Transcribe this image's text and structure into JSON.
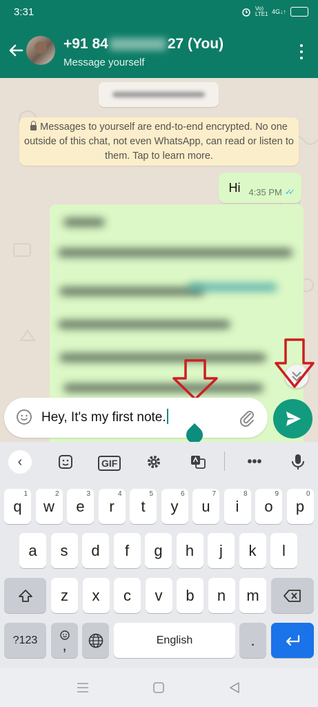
{
  "status": {
    "time": "3:31",
    "net": "Vo) LTE1",
    "sim": "4G↓↑",
    "battery": "47"
  },
  "header": {
    "phone_prefix": "+91 84",
    "phone_suffix": "27 (You)",
    "subtitle": "Message yourself"
  },
  "chat": {
    "notice": "Messages to yourself are end-to-end encrypted. No one outside of this chat, not even WhatsApp, can read or listen to them. Tap to learn more.",
    "out_text": "Hi",
    "out_time": "4:35 PM",
    "ticks": "✓✓"
  },
  "composer": {
    "text": "Hey, It's my first note."
  },
  "keyboard": {
    "gif": "GIF",
    "row1": [
      {
        "k": "q",
        "n": "1"
      },
      {
        "k": "w",
        "n": "2"
      },
      {
        "k": "e",
        "n": "3"
      },
      {
        "k": "r",
        "n": "4"
      },
      {
        "k": "t",
        "n": "5"
      },
      {
        "k": "y",
        "n": "6"
      },
      {
        "k": "u",
        "n": "7"
      },
      {
        "k": "i",
        "n": "8"
      },
      {
        "k": "o",
        "n": "9"
      },
      {
        "k": "p",
        "n": "0"
      }
    ],
    "row2": [
      "a",
      "s",
      "d",
      "f",
      "g",
      "h",
      "j",
      "k",
      "l"
    ],
    "row3": [
      "z",
      "x",
      "c",
      "v",
      "b",
      "n",
      "m"
    ],
    "sym": "?123",
    "comma": ",",
    "space": "English",
    "period": "."
  },
  "colors": {
    "header": "#0d7c66",
    "send": "#129b7e",
    "enter": "#1a73e8",
    "annotation": "#cc1f1f"
  }
}
